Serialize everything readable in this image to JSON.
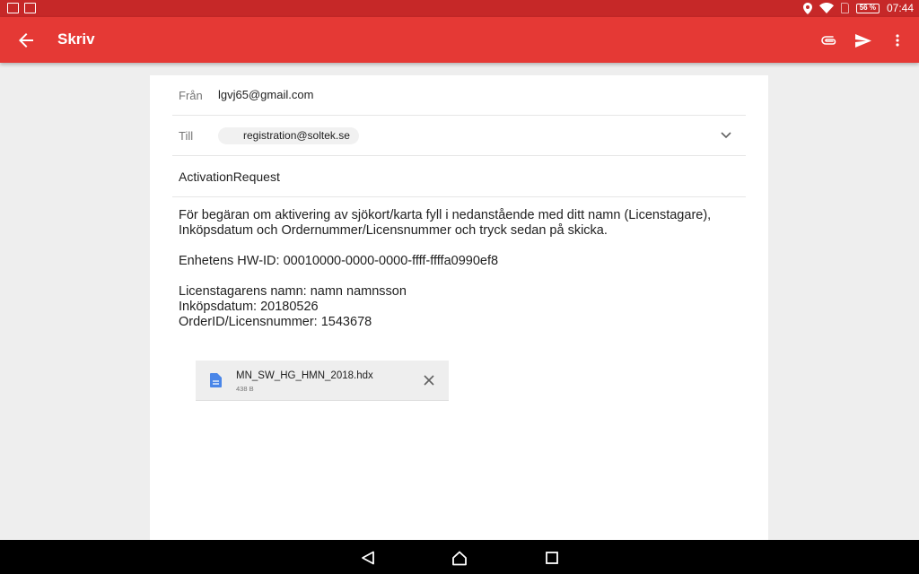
{
  "status_bar": {
    "time": "07:44",
    "battery": "56 %",
    "icons": [
      "notification-icon",
      "image-icon",
      "location-icon",
      "wifi-icon",
      "sim-icon",
      "battery-icon"
    ]
  },
  "app_bar": {
    "title": "Skriv",
    "icons": [
      "back-arrow-icon",
      "attach-icon",
      "send-icon",
      "more-vert-icon"
    ]
  },
  "compose": {
    "from_label": "Från",
    "from_value": "lgvj65@gmail.com",
    "to_label": "Till",
    "to_recipient": "registration@soltek.se",
    "subject": "ActivationRequest",
    "body_lines": [
      "För begäran om aktivering av sjökort/karta fyll i nedanstående med ditt namn (Licenstagare),",
      "Inköpsdatum och Ordernummer/Licensnummer och tryck sedan på skicka.",
      "",
      "Enhetens HW-ID: 00010000-0000-0000-ffff-ffffa0990ef8",
      "",
      "Licenstagarens namn: namn namnsson",
      "Inköpsdatum: 20180526",
      "OrderID/Licensnummer: 1543678"
    ],
    "attachment": {
      "name": "MN_SW_HG_HMN_2018.hdx",
      "size": "438 B"
    }
  },
  "nav_bar": {
    "icons": [
      "back-triangle-icon",
      "home-icon",
      "recents-icon"
    ]
  },
  "colors": {
    "status_bar": "#c62828",
    "app_bar": "#e53935",
    "background": "#eeeeee",
    "attachment_icon": "#4a86e8"
  }
}
